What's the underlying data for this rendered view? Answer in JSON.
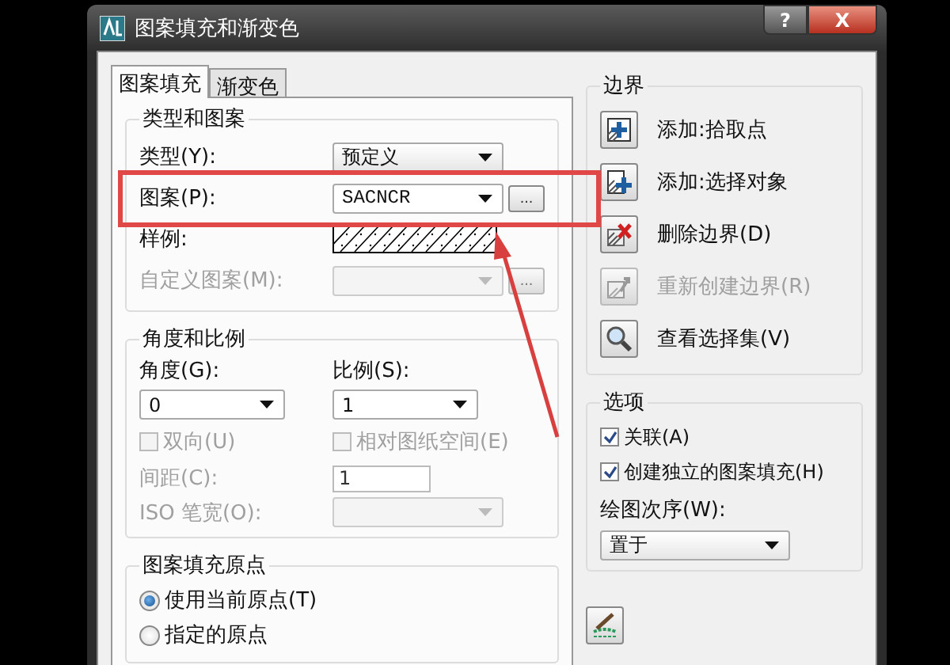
{
  "window": {
    "title": "图案填充和渐变色",
    "buttons": [
      {
        "kind": "help",
        "label": "?"
      },
      {
        "kind": "close",
        "label": "X"
      }
    ]
  },
  "tabs": [
    {
      "label": "图案填充",
      "selected": true
    },
    {
      "label": "渐变色",
      "selected": false
    }
  ],
  "type_and_pattern": {
    "title": "类型和图案",
    "rows": [
      {
        "kind": "combo",
        "label": "类型(Y):",
        "value": "预定义",
        "disabled": false
      },
      {
        "kind": "combo",
        "label": "图案(P):",
        "value": "SACNCR",
        "disabled": false,
        "browse": "..."
      },
      {
        "kind": "swatch",
        "label": "样例:",
        "disabled": false
      },
      {
        "kind": "combo",
        "label": "自定义图案(M):",
        "disabled": true,
        "browse": "..."
      }
    ]
  },
  "angle_and_scale": {
    "title": "角度和比例",
    "angle": {
      "label": "角度(G):",
      "value": "0"
    },
    "scale": {
      "label": "比例(S):",
      "value": "1"
    },
    "checks": [
      {
        "label": "双向(U)",
        "checked": false,
        "disabled": true
      },
      {
        "label": "相对图纸空间(E)",
        "checked": false,
        "disabled": true
      }
    ],
    "spacing": {
      "label": "间距(C):",
      "value": "1",
      "disabled": true
    },
    "iso_pen_width": {
      "label": "ISO 笔宽(O):",
      "disabled": true
    }
  },
  "hatch_origin": {
    "title": "图案填充原点",
    "radios": [
      {
        "label": "使用当前原点(T)",
        "selected": true
      },
      {
        "label": "指定的原点",
        "selected": false
      }
    ]
  },
  "boundaries": {
    "title": "边界",
    "buttons": [
      {
        "kind": "pick",
        "label": "添加:拾取点",
        "disabled": false
      },
      {
        "kind": "select",
        "label": "添加:选择对象",
        "disabled": false
      },
      {
        "kind": "remove",
        "label": "删除边界(D)",
        "disabled": false
      },
      {
        "kind": "recreate",
        "label": "重新创建边界(R)",
        "disabled": true
      },
      {
        "kind": "view",
        "label": "查看选择集(V)",
        "disabled": false
      }
    ]
  },
  "options": {
    "title": "选项",
    "checks": [
      {
        "label": "关联(A)",
        "checked": true
      },
      {
        "label": "创建独立的图案填充(H)",
        "checked": true
      }
    ],
    "draw_order": {
      "label": "绘图次序(W):",
      "value": "置于"
    }
  },
  "inherit_button": {
    "kind": "inherit"
  }
}
